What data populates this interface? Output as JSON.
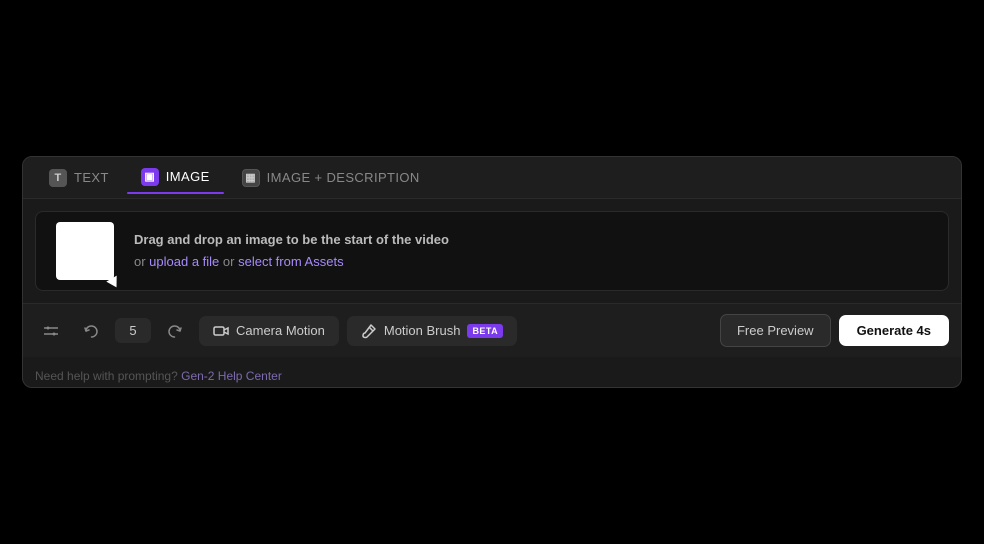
{
  "tabs": [
    {
      "id": "text",
      "label": "TEXT",
      "icon": "T",
      "active": false
    },
    {
      "id": "image",
      "label": "IMAGE",
      "icon": "▣",
      "active": true
    },
    {
      "id": "image-desc",
      "label": "IMAGE + DESCRIPTION",
      "icon": "▦",
      "active": false
    }
  ],
  "dropzone": {
    "main_text": "Drag and drop an image to be the start of the video",
    "sub_text_prefix": "or ",
    "upload_link": "upload a file",
    "sub_text_middle": " or ",
    "assets_link": "select from Assets"
  },
  "toolbar": {
    "settings_icon": "⚙",
    "undo_icon": "↺",
    "counter_value": "5",
    "redo_icon": "↻",
    "camera_motion_label": "Camera Motion",
    "motion_brush_label": "Motion Brush",
    "beta_label": "BETA",
    "free_preview_label": "Free Preview",
    "generate_label": "Generate 4s"
  },
  "help": {
    "prefix": "Need help with prompting?",
    "link_label": "Gen-2 Help Center"
  },
  "colors": {
    "accent": "#7c3aed",
    "bg_dark": "#000",
    "bg_panel": "#1a1a1a",
    "bg_toolbar": "#1e1e1e"
  }
}
